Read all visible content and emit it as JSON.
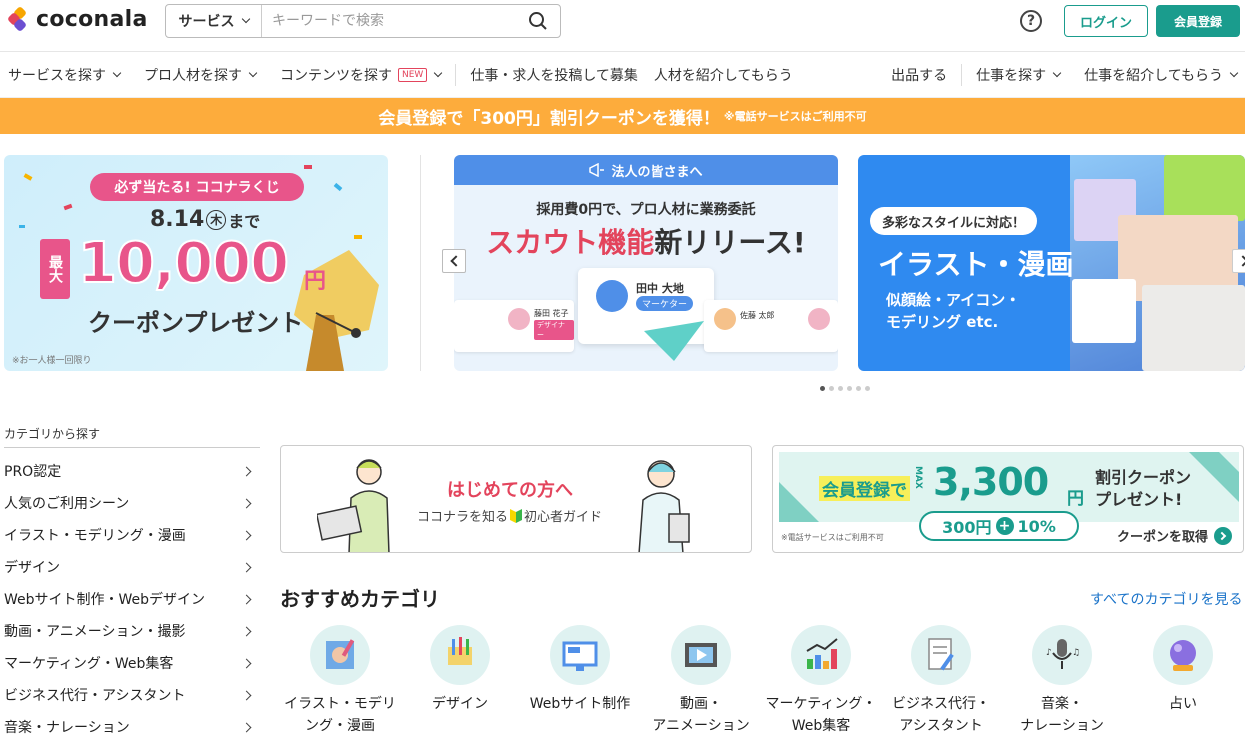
{
  "header": {
    "logo_text": "coconala",
    "search_category": "サービス",
    "search_placeholder": "キーワードで検索",
    "help_icon": "?",
    "login": "ログイン",
    "signup": "会員登録"
  },
  "nav": {
    "items": [
      "サービスを探す",
      "プロ人材を探す",
      "コンテンツを探す",
      "仕事・求人を投稿して募集",
      "人材を紹介してもらう"
    ],
    "new_badge": "NEW",
    "right_items": [
      "出品する",
      "仕事を探す",
      "仕事を紹介してもらう"
    ]
  },
  "promo_bar": {
    "text": "会員登録で「300円」割引クーポンを獲得！",
    "note": "※電話サービスはご利用不可"
  },
  "banners": {
    "b1": {
      "badge": "必ず当たる! ココナラくじ",
      "date": "8.14",
      "weekday": "木",
      "until": "まで",
      "max": "最大",
      "amount": "10,000",
      "yen": "円",
      "present": "クーポンプレゼント",
      "note": "※お一人様一回限り"
    },
    "b2": {
      "header": "法人の皆さまへ",
      "sub": "採用費0円で、プロ人材に業務委託",
      "title_a": "スカウト機能",
      "title_b": "新リリース!",
      "card_name": "田中 大地",
      "card_role": "マーケター",
      "left_name": "藤田 花子",
      "left_role": "デザイナー",
      "right_name": "佐藤 太郎"
    },
    "b3": {
      "badge": "多彩なスタイルに対応！",
      "title": "イラスト・漫画",
      "sub1": "似顔絵・アイコン・",
      "sub2": "モデリング etc."
    }
  },
  "sidebar": {
    "title": "カテゴリから探す",
    "items": [
      "PRO認定",
      "人気のご利用シーン",
      "イラスト・モデリング・漫画",
      "デザイン",
      "Webサイト制作・Webデザイン",
      "動画・アニメーション・撮影",
      "マーケティング・Web集客",
      "ビジネス代行・アシスタント",
      "音楽・ナレーション"
    ]
  },
  "guide": {
    "title": "はじめての方へ",
    "sub_a": "ココナラを知る",
    "sub_b": "初心者ガイド"
  },
  "coupon": {
    "a": "会員登録で",
    "max": "MAX",
    "amount": "3,300",
    "yen": "円",
    "b1": "割引クーポン",
    "b2": "プレゼント!",
    "pill": "300円",
    "pill_plus": "+",
    "pill_b": "10%",
    "note": "※電話サービスはご利用不可",
    "cta": "クーポンを取得"
  },
  "recommended": {
    "title": "おすすめカテゴリ",
    "link": "すべてのカテゴリを見る",
    "categories": [
      {
        "l1": "イラスト・モデリ",
        "l2": "ング・漫画"
      },
      {
        "l1": "デザイン",
        "l2": ""
      },
      {
        "l1": "Webサイト制作",
        "l2": ""
      },
      {
        "l1": "動画・",
        "l2": "アニメーション"
      },
      {
        "l1": "マーケティング・",
        "l2": "Web集客"
      },
      {
        "l1": "ビジネス代行・",
        "l2": "アシスタント"
      },
      {
        "l1": "音楽・",
        "l2": "ナレーション"
      },
      {
        "l1": "占い",
        "l2": ""
      }
    ]
  },
  "colors": {
    "brand": "#1a9c8d",
    "promo": "#fdac3c",
    "link": "#1a73c9",
    "pink": "#e3445c"
  },
  "icons": [
    "logo-icon",
    "search-icon",
    "help-icon",
    "chevron-down-icon",
    "chevron-right-icon",
    "chevron-left-icon",
    "megaphone-icon"
  ]
}
